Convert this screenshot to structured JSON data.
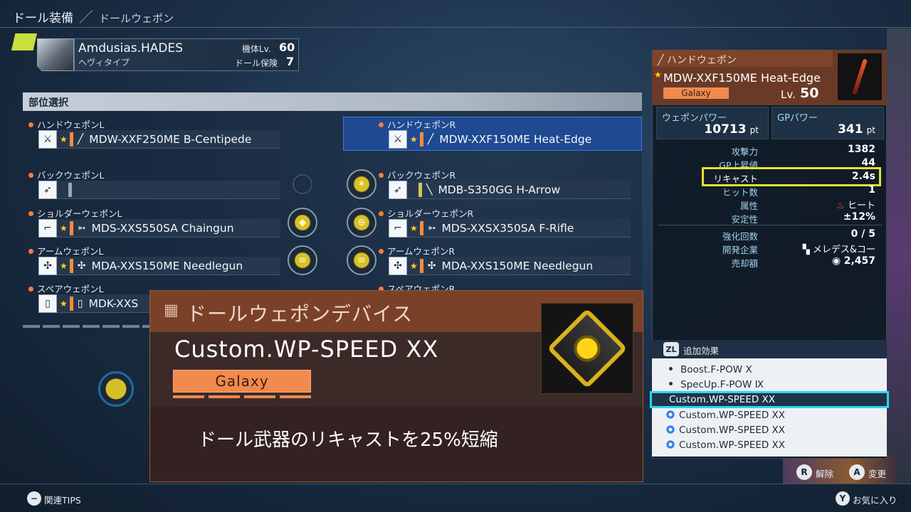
{
  "breadcrumb": {
    "title": "ドール装備",
    "sub": "ドールウェポン"
  },
  "robot": {
    "name": "Amdusias.HADES",
    "type": "ヘヴィタイプ",
    "level_label": "機体Lv.",
    "level_value": "60",
    "insurance_label": "ドール保険",
    "insurance_value": "7"
  },
  "parts": {
    "title": "部位選択",
    "left": [
      {
        "label": "ハンドウェポンL",
        "weapon": "MDW-XXF250ME B-Centipede"
      },
      {
        "label": "バックウェポンL",
        "weapon": ""
      },
      {
        "label": "ショルダーウェポンL",
        "weapon": "MDS-XXS550SA Chaingun"
      },
      {
        "label": "アームウェポンL",
        "weapon": "MDA-XXS150ME Needlegun"
      },
      {
        "label": "スペアウェポンL",
        "weapon": "MDK-XXS"
      }
    ],
    "right": [
      {
        "label": "ハンドウェポンR",
        "weapon": "MDW-XXF150ME Heat-Edge"
      },
      {
        "label": "バックウェポンR",
        "weapon": "MDB-S350GG H-Arrow"
      },
      {
        "label": "ショルダーウェポンR",
        "weapon": "MDS-XXSX350SA F-Rifle"
      },
      {
        "label": "アームウェポンR",
        "weapon": "MDA-XXS150ME Needlegun"
      },
      {
        "label": "スペアウェポンR",
        "weapon": ""
      }
    ]
  },
  "popup": {
    "tag": "ドールウェポンデバイス",
    "name": "Custom.WP-SPEED ⅩⅩ",
    "rarity": "Galaxy",
    "description": "ドール武器のリキャストを25%短縮"
  },
  "detail": {
    "category": "ハンドウェポン",
    "name": "MDW-XXF150ME Heat-Edge",
    "rarity": "Galaxy",
    "level_label": "Lv.",
    "level_value": "50",
    "weapon_power_label": "ウェポンパワー",
    "weapon_power_value": "10713",
    "gp_power_label": "GPパワー",
    "gp_power_value": "341",
    "unit": "pt",
    "stats": [
      {
        "label": "攻撃力",
        "value": "1382"
      },
      {
        "label": "GP上昇値",
        "value": "44"
      },
      {
        "label": "リキャスト",
        "value": "2.4s"
      },
      {
        "label": "ヒット数",
        "value": "1"
      },
      {
        "label": "属性",
        "value": "ヒート"
      },
      {
        "label": "安定性",
        "value": "±12%"
      }
    ],
    "stats2": [
      {
        "label": "強化回数",
        "value": "0 / 5"
      },
      {
        "label": "開発企業",
        "value": "メレデス&コー"
      },
      {
        "label": "売却額",
        "value": "2,457"
      }
    ],
    "extra_title": "追加効果",
    "extra_button": "ZL",
    "extras": [
      "Boost.F-POW Ⅹ",
      "SpecUp.F-POW Ⅸ",
      "Custom.WP-SPEED ⅩⅩ",
      "Custom.WP-SPEED ⅩⅩ",
      "Custom.WP-SPEED ⅩⅩ",
      "Custom.WP-SPEED ⅩⅩ"
    ]
  },
  "hints": {
    "tips": "関連TIPS",
    "release": "解除",
    "change": "変更",
    "favorite": "お気に入り",
    "r_btn": "R",
    "a_btn": "A",
    "y_btn": "Y",
    "minus_btn": "−"
  },
  "colors": {
    "accent_orange": "#f08a4e",
    "highlight_yellow": "#e6e031",
    "highlight_cyan": "#2ad6f0",
    "selected_blue": "#1f4a92"
  }
}
